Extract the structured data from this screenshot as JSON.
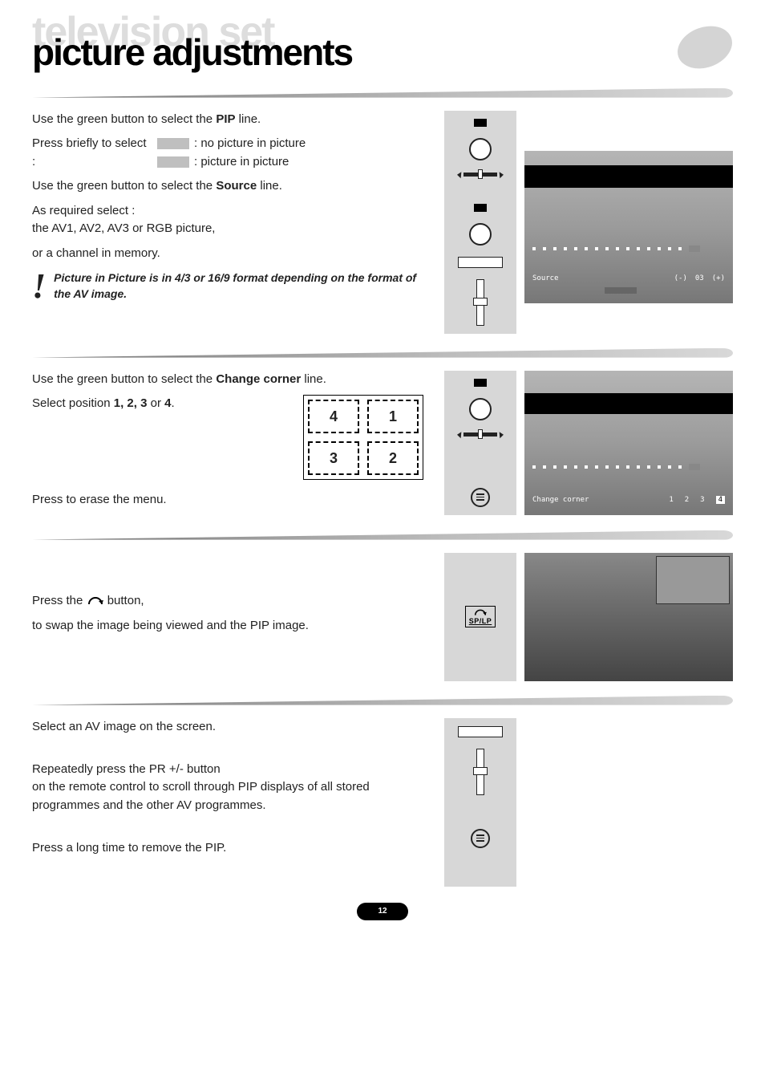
{
  "header": {
    "ghost_title": "television set",
    "title": "picture adjustments"
  },
  "section1": {
    "line1_pre": "Use the green button to select the ",
    "line1_bold": "PIP",
    "line1_post": " line.",
    "line2": "Press briefly to select :",
    "opt1": ": no picture in picture",
    "opt2": ": picture in picture",
    "line3_pre": "Use the green button to select the ",
    "line3_bold": "Source",
    "line3_post": " line.",
    "line4a": "As required select :",
    "line4b": "the AV1, AV2, AV3 or RGB picture,",
    "line5": "or a channel in memory.",
    "note": "Picture in Picture is in 4/3 or 16/9 format depending on the format of the AV image.",
    "osd_source": "Source",
    "osd_minus": "(-)",
    "osd_val": "03",
    "osd_plus": "(+)"
  },
  "section2": {
    "line1_pre": "Use the green button to select the ",
    "line1_bold": "Change corner",
    "line1_post": " line.",
    "line2_pre": "Select position ",
    "line2_bold": "1, 2, 3",
    "line2_mid": " or ",
    "line2_bold2": "4",
    "line2_post": ".",
    "grid": {
      "tl": "4",
      "tr": "1",
      "bl": "3",
      "br": "2"
    },
    "line3": "Press to erase the menu.",
    "osd_change": "Change corner",
    "osd_nums": [
      "1",
      "2",
      "3",
      "4"
    ]
  },
  "section3": {
    "line1": "Press the ",
    "line1_post": " button,",
    "line2": "to swap the image being viewed and the PIP image.",
    "splp": "SP/LP"
  },
  "section4": {
    "line1": "Select an AV image on the screen.",
    "line2": "Repeatedly press the PR +/- button",
    "line3": "on the remote control to scroll through PIP displays of all stored programmes and the other AV programmes.",
    "line4": "Press a long time to remove the PIP."
  },
  "page_number": "12",
  "exclaim": "!"
}
